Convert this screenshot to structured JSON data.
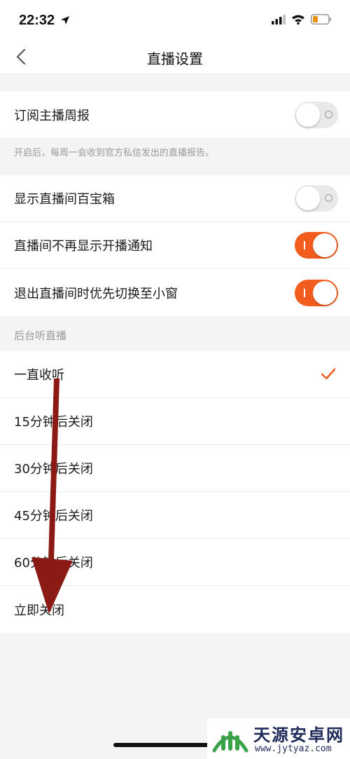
{
  "status_bar": {
    "time": "22:32",
    "icons": [
      "location-arrow-icon",
      "cellular-signal-icon",
      "wifi-icon",
      "battery-low-icon"
    ]
  },
  "nav": {
    "title": "直播设置",
    "back_icon": "chevron-left-icon"
  },
  "section1": {
    "rows": [
      {
        "label": "订阅主播周报",
        "toggle": false
      }
    ],
    "hint": "开启后，每周一会收到官方私信发出的直播报告。"
  },
  "section2": {
    "rows": [
      {
        "label": "显示直播间百宝箱",
        "toggle": false
      },
      {
        "label": "直播间不再显示开播通知",
        "toggle": true
      },
      {
        "label": "退出直播间时优先切换至小窗",
        "toggle": true
      }
    ]
  },
  "background_listen": {
    "title": "后台听直播",
    "options": [
      {
        "label": "一直收听",
        "selected": true
      },
      {
        "label": "15分钟后关闭",
        "selected": false
      },
      {
        "label": "30分钟后关闭",
        "selected": false
      },
      {
        "label": "45分钟后关闭",
        "selected": false
      },
      {
        "label": "60分钟后关闭",
        "selected": false
      },
      {
        "label": "立即关闭",
        "selected": false
      }
    ]
  },
  "watermark": {
    "name": "天源安卓网",
    "url": "www.jytyaz.com"
  },
  "colors": {
    "accent": "#f25c1d",
    "toggle_off": "#e9e9eb",
    "arrow": "#8b1a14",
    "background": "#f4f4f6"
  }
}
